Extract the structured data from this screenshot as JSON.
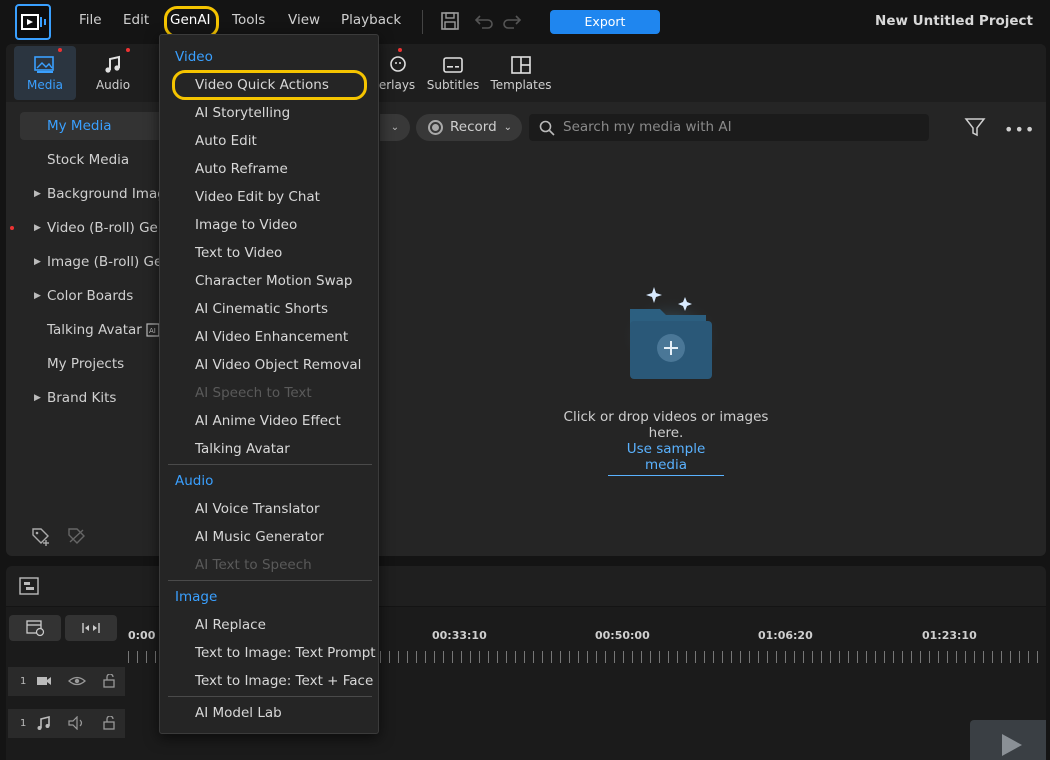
{
  "menubar": {
    "file": "File",
    "edit": "Edit",
    "genai": "GenAI",
    "tools": "Tools",
    "view": "View",
    "playback": "Playback",
    "export_label": "Export",
    "project_title": "New Untitled Project"
  },
  "tabs": {
    "media": "Media",
    "audio": "Audio",
    "overlays_partial": "erlays",
    "subtitles": "Subtitles",
    "templates": "Templates"
  },
  "sidebar": {
    "items": [
      {
        "label": "My Media"
      },
      {
        "label": "Stock Media"
      },
      {
        "label": "Background Image"
      },
      {
        "label": "Video (B-roll) Gene"
      },
      {
        "label": "Image (B-roll) Gen"
      },
      {
        "label": "Color Boards"
      },
      {
        "label": "Talking Avatar"
      },
      {
        "label": "My Projects"
      },
      {
        "label": "Brand Kits"
      }
    ]
  },
  "media_toolbar": {
    "record_label": "Record",
    "search_placeholder": "Search my media with AI"
  },
  "drop_zone": {
    "text": "Click or drop videos or images here.",
    "sample_link": "Use sample media"
  },
  "timeline": {
    "times": [
      "0:00",
      "00:33:10",
      "00:50:00",
      "01:06:20",
      "01:23:10"
    ],
    "tracks": [
      {
        "num": "1"
      },
      {
        "num": "1"
      }
    ]
  },
  "genai_menu": {
    "video_header": "Video",
    "video_items": [
      "Video Quick Actions",
      "AI Storytelling",
      "Auto Edit",
      "Auto Reframe",
      "Video Edit by Chat",
      "Image to Video",
      "Text to Video",
      "Character Motion Swap",
      "AI Cinematic Shorts",
      "AI Video Enhancement",
      "AI Video Object Removal",
      "AI Speech to Text",
      "AI Anime Video Effect",
      "Talking Avatar"
    ],
    "audio_header": "Audio",
    "audio_items": [
      "AI Voice Translator",
      "AI Music Generator",
      "AI Text to Speech"
    ],
    "image_header": "Image",
    "image_items": [
      "AI Replace",
      "Text to Image: Text Prompt",
      "Text to Image: Text + Face"
    ],
    "model_lab": "AI Model Lab"
  },
  "colors": {
    "accent": "#3aa0ff",
    "highlight_ring": "#f5c400",
    "export_button": "#1f86ef"
  }
}
